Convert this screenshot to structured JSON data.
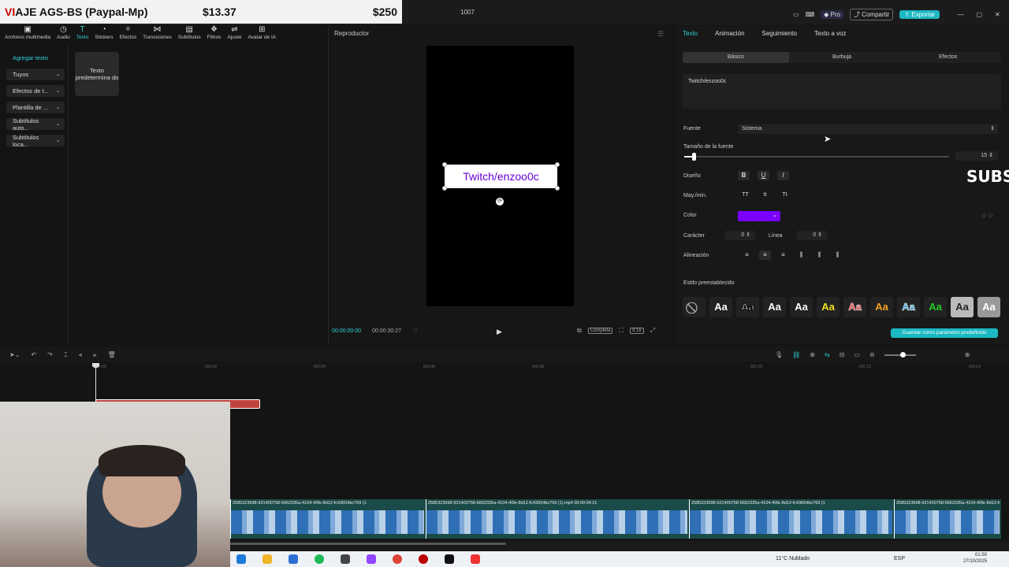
{
  "overlay": {
    "banner_title_prefix": "VI",
    "banner_title": "AJE AGS-BS (Paypal-Mp)",
    "price1": "$13.37",
    "price2": "$250"
  },
  "window": {
    "title": "1007",
    "pro_label": "Pro",
    "share_label": "Compartir",
    "export_label": "Exportar"
  },
  "toolbar": [
    {
      "icon": "▣",
      "label": "Archivos multimedia"
    },
    {
      "icon": "◷",
      "label": "Audio"
    },
    {
      "icon": "T",
      "label": "Texto"
    },
    {
      "icon": "◔",
      "label": "Stickers"
    },
    {
      "icon": "✧",
      "label": "Efectos"
    },
    {
      "icon": "⋈",
      "label": "Transiciones"
    },
    {
      "icon": "▤",
      "label": "Subtítulos"
    },
    {
      "icon": "❖",
      "label": "Filtros"
    },
    {
      "icon": "⇌",
      "label": "Ajuste"
    },
    {
      "icon": "⊞",
      "label": "Avatar de IA"
    }
  ],
  "leftnav": [
    "Agregar texto",
    "Tuyos",
    "Efectos de t...",
    "Plantilla de ...",
    "Subtítulos auto...",
    "Subtítulos loca..."
  ],
  "preset_card": "Texto predetermina do",
  "player": {
    "title": "Reproductor",
    "overlay_text": "Twitch/enzoo0c",
    "time_current": "00:00:00:00",
    "time_total": "00:00:30:27",
    "full_label": "Completa",
    "ratio_label": "9:16"
  },
  "right": {
    "tabs": [
      "Texto",
      "Animación",
      "Seguimiento",
      "Texto a voz"
    ],
    "subtabs": [
      "Básico",
      "Burbuja",
      "Efectos"
    ],
    "text_value": "Twitch/enzoo0c",
    "font_label": "Fuente",
    "font_value": "Sistema",
    "size_label": "Tamaño de la fuente",
    "size_value": "15",
    "design_label": "Diseño",
    "case_label": "May./min.",
    "color_label": "Color",
    "color_hex": "#7a00ff",
    "char_label": "Carácter",
    "char_value": "0",
    "line_label": "Línea",
    "line_value": "0",
    "align_label": "Alineación",
    "preset_label": "Estilo preestablecido",
    "presets": [
      "Aa",
      "Aa",
      "Aa",
      "Aa",
      "Aa",
      "Aa",
      "Aa",
      "Aa",
      "Aa",
      "Aa",
      "Aa"
    ],
    "save_label": "Guardar como parámetro predefinido",
    "subs_overlay": "SUBS"
  },
  "timeline": {
    "ticks": [
      "00:00",
      "|00:02",
      "|00:04",
      "|00:06",
      "|00:08",
      "|00:10",
      "|00:12",
      "|00:14"
    ],
    "clip_labels": [
      "2585323698-921400758-6662335a-4104-40fe-8d12-fc43654bc769 (1",
      "2585323698-921400758-6662335a-4104-40fe-8d12-fc43654bc769 (1).mp4  00:00:04:21",
      "2585323698-921400758-6662335a-4104-40fe-8d12-fc43654bc769 (1",
      "2585323698-921400758-6662335a-4104-40fe-8d12-fc43654bc769"
    ]
  },
  "taskbar": {
    "weather": "11°C  Nublado",
    "lang": "ESP",
    "time": "01:50",
    "date": "27/10/2025"
  }
}
